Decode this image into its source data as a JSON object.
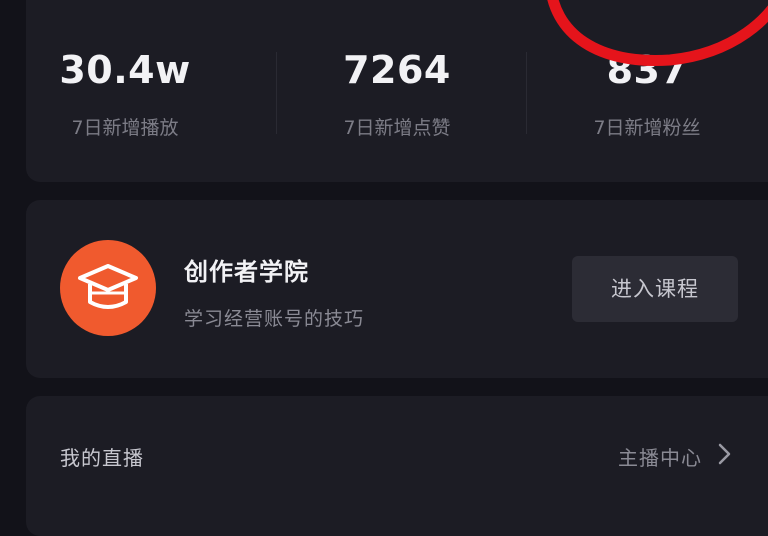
{
  "stats": [
    {
      "value": "30.4w",
      "label": "7日新增播放"
    },
    {
      "value": "7264",
      "label": "7日新增点赞"
    },
    {
      "value": "837",
      "label": "7日新增粉丝"
    }
  ],
  "academy": {
    "title": "创作者学院",
    "subtitle": "学习经营账号的技巧",
    "button_label": "进入课程",
    "icon_color": "#f05a2e"
  },
  "live": {
    "title": "我的直播",
    "link_label": "主播中心"
  },
  "colors": {
    "background": "#121219",
    "card": "#1c1c24",
    "accent": "#f05a2e",
    "annotation": "#e5141b"
  }
}
